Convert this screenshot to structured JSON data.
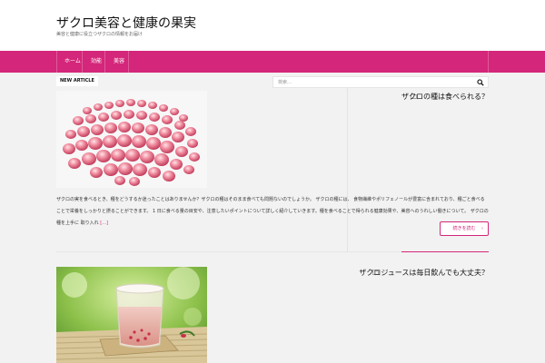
{
  "site": {
    "title": "ザクロ美容と健康の果実",
    "description": "美容と健康に役立つザクロの情報をお届け"
  },
  "nav": {
    "items": [
      {
        "label": "ホーム"
      },
      {
        "label": "効能"
      },
      {
        "label": "美容"
      }
    ]
  },
  "badge": {
    "label": "NEW ARTICLE"
  },
  "search": {
    "placeholder": "検索…"
  },
  "posts": [
    {
      "title": "ザクロの種は食べられる？",
      "excerpt": "ザクロの実を食べるとき、種をどうするか迷ったことはありませんか？ザクロの種はそのまま食べても問題ないのでしょうか。 ザクロの種には、 食物繊維やポリフェノールが豊富に含まれており、種ごと食べることで栄養をしっかりと摂ることができます。 1 日に食べる量の目安や、注意したいポイントについて詳しく紹介していきます。種を食べることで得られる健康効果や、美容へのうれしい働きについて。 ザクロの種を上手に 取り入れ",
      "more": "[…]",
      "readmore": "続きを読む"
    },
    {
      "title": "ザクロジュースは毎日飲んでも大丈夫？"
    }
  ],
  "colors": {
    "accent": "#d4267a",
    "background": "#f2f2f2"
  }
}
